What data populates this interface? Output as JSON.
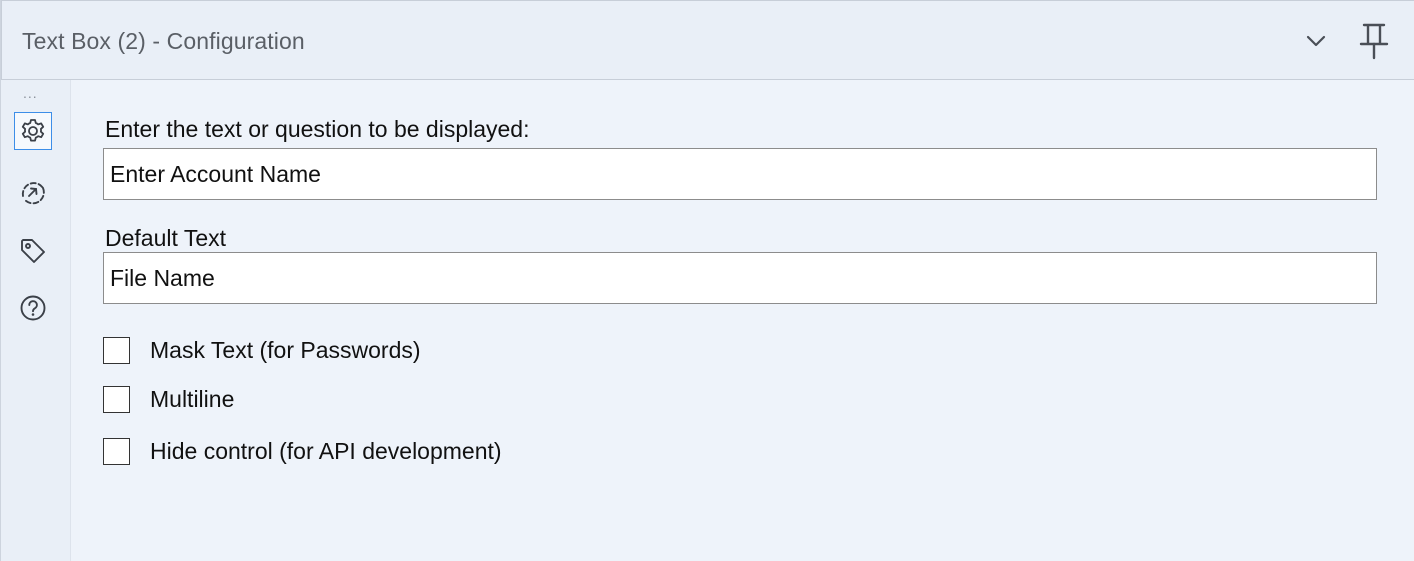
{
  "header": {
    "title": "Text Box (2) - Configuration",
    "collapse_icon": "chevron-down-icon",
    "pin_icon": "pin-icon"
  },
  "sidebar": {
    "overflow_dots": "...",
    "items": [
      {
        "icon": "gear-icon",
        "active": true
      },
      {
        "icon": "connection-arrow-icon",
        "active": false
      },
      {
        "icon": "tag-icon",
        "active": false
      },
      {
        "icon": "help-icon",
        "active": false
      }
    ]
  },
  "form": {
    "question_label": "Enter the text or question to be displayed:",
    "question_value": "Enter Account Name",
    "default_label": "Default Text",
    "default_value": "File Name",
    "checkboxes": [
      {
        "label": "Mask Text (for Passwords)",
        "checked": false
      },
      {
        "label": "Multiline",
        "checked": false
      },
      {
        "label": "Hide control (for API development)",
        "checked": false
      }
    ]
  },
  "colors": {
    "background": "#eef3fa",
    "accent": "#3d8ee8",
    "border": "#8c8c8c"
  }
}
